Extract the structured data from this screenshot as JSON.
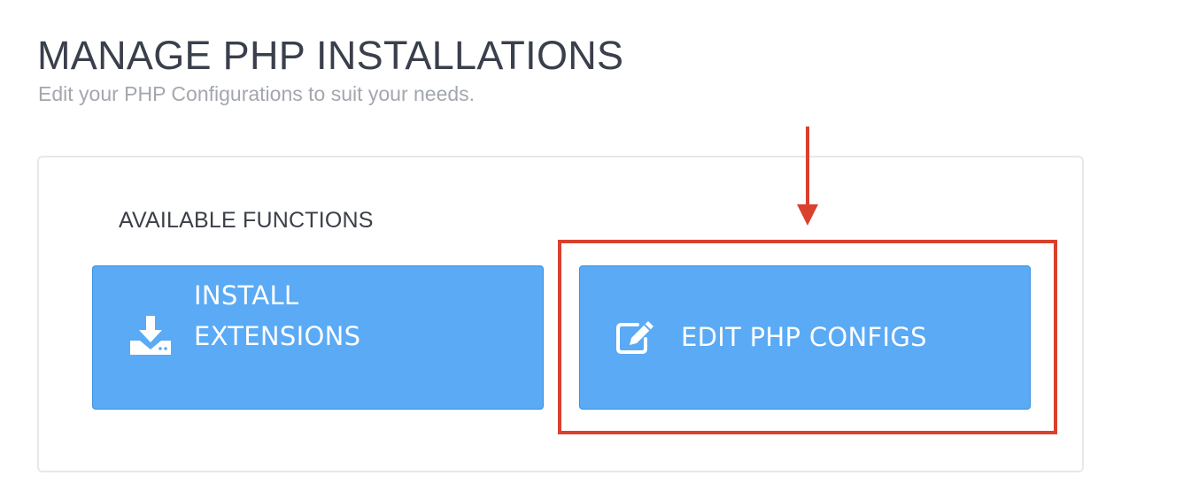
{
  "header": {
    "title": "MANAGE PHP INSTALLATIONS",
    "subtitle": "Edit your PHP Configurations to suit your needs."
  },
  "functions": {
    "heading": "AVAILABLE FUNCTIONS",
    "install_extensions": {
      "label_line1": "INSTALL",
      "label_line2": "EXTENSIONS",
      "icon": "download-icon"
    },
    "edit_configs": {
      "label": "EDIT PHP CONFIGS",
      "icon": "edit-icon"
    }
  },
  "colors": {
    "button_bg": "#5aaaf5",
    "annotation_red": "#d9412e",
    "title_text": "#3a3f4c",
    "subtitle_text": "#a3a7ad"
  }
}
